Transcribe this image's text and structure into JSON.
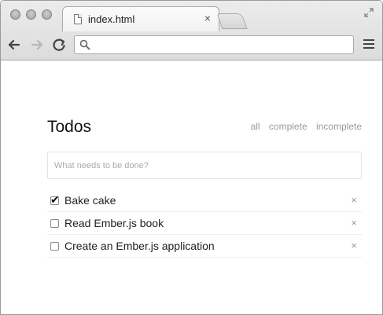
{
  "browser": {
    "tab": {
      "title": "index.html",
      "close_glyph": "×"
    },
    "address": {
      "value": "",
      "placeholder": ""
    },
    "icons": [
      "document-icon",
      "back-arrow-icon",
      "forward-arrow-icon",
      "reload-icon",
      "search-icon",
      "hamburger-menu-icon",
      "resize-icon"
    ]
  },
  "app": {
    "title": "Todos",
    "filters": [
      {
        "label": "all"
      },
      {
        "label": "complete"
      },
      {
        "label": "incomplete"
      }
    ],
    "new_todo": {
      "placeholder": "What needs to be done?",
      "value": ""
    },
    "todos": [
      {
        "label": "Bake cake",
        "completed": true
      },
      {
        "label": "Read Ember.js book",
        "completed": false
      },
      {
        "label": "Create an Ember.js application",
        "completed": false
      }
    ],
    "check_glyph": "✔",
    "remove_glyph": "×"
  },
  "colors": {
    "muted_text": "#9a9a9a",
    "chrome_bg": "#dcdcdc"
  }
}
